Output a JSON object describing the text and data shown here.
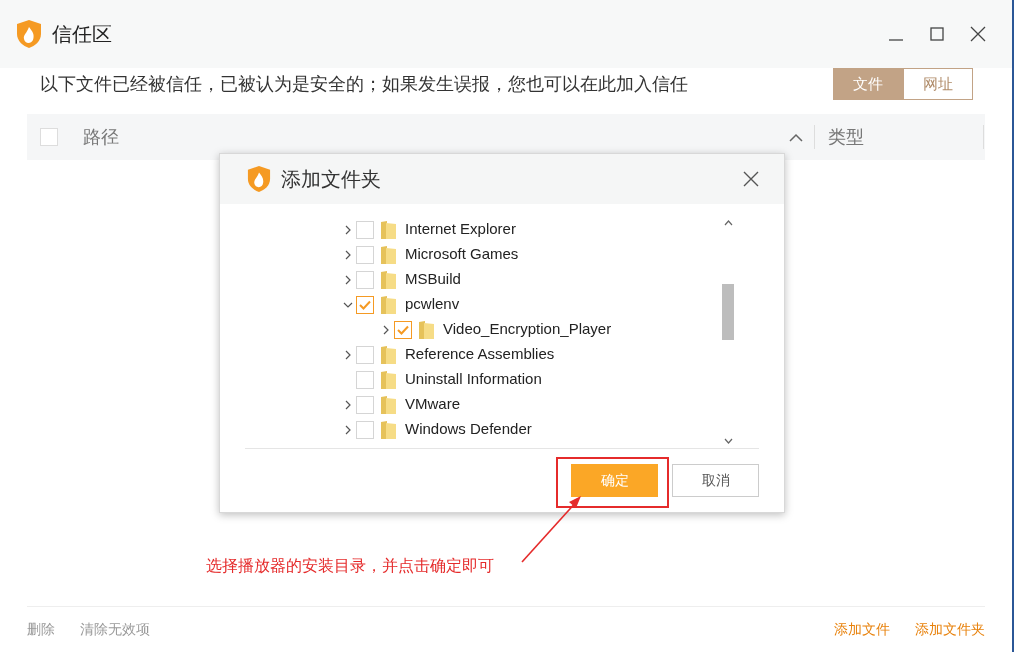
{
  "window": {
    "title": "信任区"
  },
  "intro": "以下文件已经被信任，已被认为是安全的；如果发生误报，您也可以在此加入信任",
  "tabs": [
    {
      "label": "文件",
      "selected": true
    },
    {
      "label": "网址",
      "selected": false
    }
  ],
  "table": {
    "columns": [
      "路径",
      "类型"
    ],
    "select_all_checked": false
  },
  "dialog": {
    "title": "添加文件夹",
    "tree": [
      {
        "label": "Internet Explorer",
        "has_children": true,
        "expanded": false,
        "checked": false
      },
      {
        "label": "Microsoft Games",
        "has_children": true,
        "expanded": false,
        "checked": false
      },
      {
        "label": "MSBuild",
        "has_children": true,
        "expanded": false,
        "checked": false
      },
      {
        "label": "pcwlenv",
        "has_children": true,
        "expanded": true,
        "checked": true,
        "children": [
          {
            "label": "Video_Encryption_Player",
            "has_children": true,
            "expanded": false,
            "checked": true
          }
        ]
      },
      {
        "label": "Reference Assemblies",
        "has_children": true,
        "expanded": false,
        "checked": false
      },
      {
        "label": "Uninstall Information",
        "has_children": false,
        "checked": false
      },
      {
        "label": "VMware",
        "has_children": true,
        "expanded": false,
        "checked": false
      },
      {
        "label": "Windows Defender",
        "has_children": true,
        "expanded": false,
        "checked": false
      }
    ],
    "buttons": [
      {
        "label": "确定",
        "kind": "primary"
      },
      {
        "label": "取消",
        "kind": "secondary"
      }
    ]
  },
  "annotation": "选择播放器的安装目录，并点击确定即可",
  "footer": {
    "left": [
      "删除",
      "清除无效项"
    ],
    "right": [
      "添加文件",
      "添加文件夹"
    ]
  }
}
